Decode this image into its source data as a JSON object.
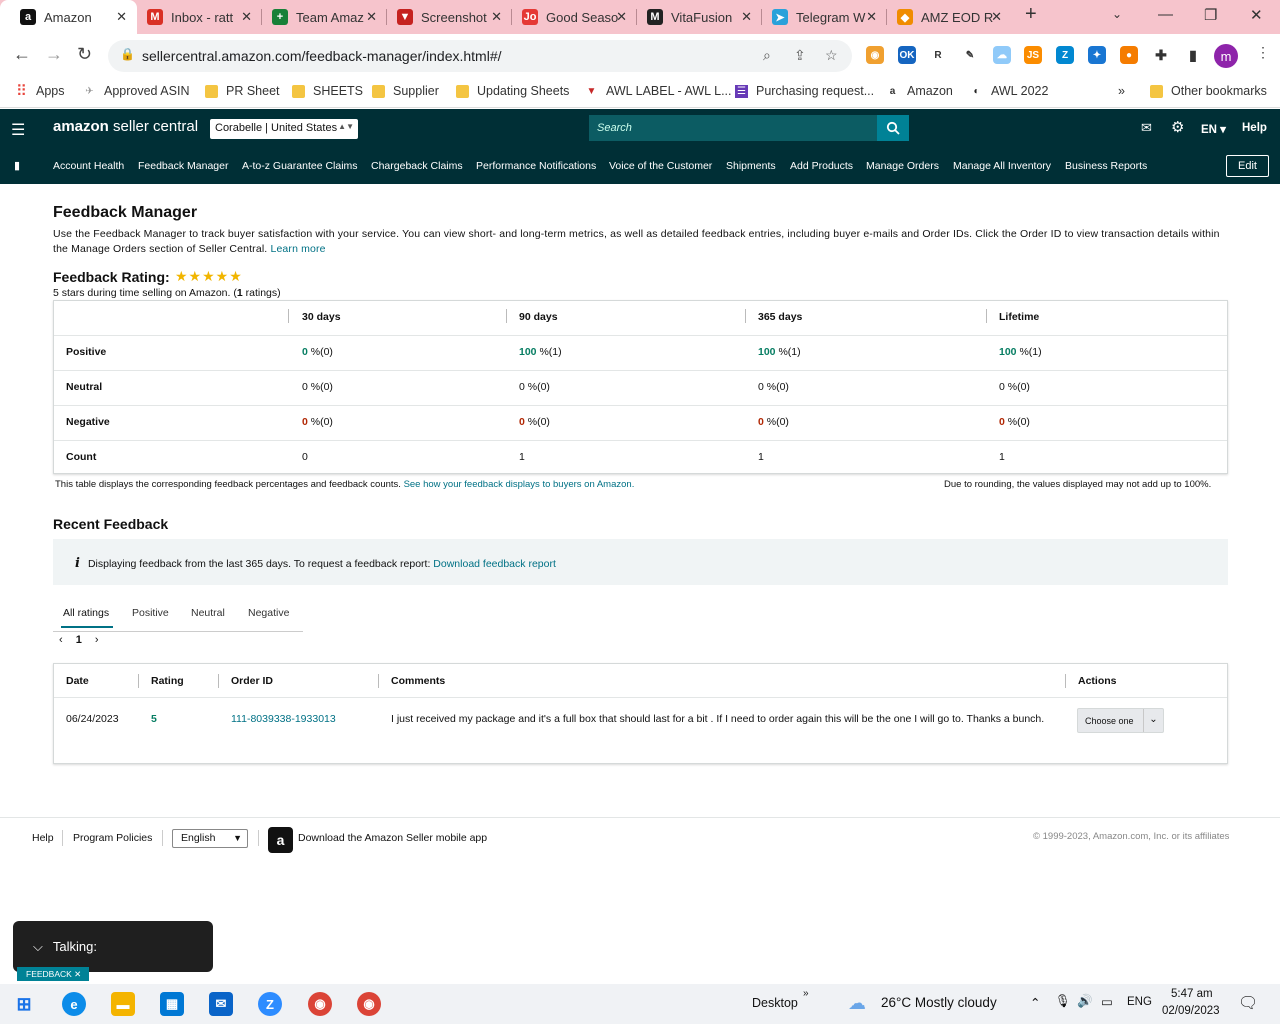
{
  "browser": {
    "tabs": [
      {
        "title": "Amazon",
        "icon": "amazon-a-icon",
        "color": "#111111",
        "letter": "a"
      },
      {
        "title": "Inbox - ratt",
        "icon": "gmail-icon",
        "color": "#d93025",
        "letter": "M"
      },
      {
        "title": "Team Amaz",
        "icon": "sheets-icon",
        "color": "#188038",
        "letter": "+"
      },
      {
        "title": "Screenshot",
        "icon": "screenshot-icon",
        "color": "#c5221f",
        "letter": "▼"
      },
      {
        "title": "Good Seaso",
        "icon": "jo-icon",
        "color": "#e53935",
        "letter": "Jo"
      },
      {
        "title": "VitaFusion",
        "icon": "vitafusion-icon",
        "color": "#222222",
        "letter": "M"
      },
      {
        "title": "Telegram W",
        "icon": "telegram-icon",
        "color": "#2aa1da",
        "letter": "➤"
      },
      {
        "title": "AMZ EOD R",
        "icon": "tag-icon",
        "color": "#f08c00",
        "letter": "◆"
      }
    ],
    "url": "sellercentral.amazon.com/feedback-manager/index.html#/",
    "profile_letter": "m",
    "bookmarks": [
      {
        "label": "Apps",
        "icon": "apps-grid-icon"
      },
      {
        "label": "Approved ASIN",
        "icon": "bookmark-icon"
      },
      {
        "label": "PR Sheet",
        "icon": "folder-icon"
      },
      {
        "label": "SHEETS",
        "icon": "folder-icon"
      },
      {
        "label": "Supplier",
        "icon": "folder-icon"
      },
      {
        "label": "Updating Sheets",
        "icon": "folder-icon"
      },
      {
        "label": "AWL LABEL - AWL L...",
        "icon": "awl-icon"
      },
      {
        "label": "Purchasing request...",
        "icon": "form-icon"
      },
      {
        "label": "Amazon",
        "icon": "amazon-a-icon"
      },
      {
        "label": "AWL 2022",
        "icon": "globe-icon"
      }
    ],
    "other_bookmarks": "Other bookmarks",
    "more_bookmarks": "»"
  },
  "header": {
    "logo_brand": "amazon",
    "logo_suffix": " seller central",
    "store": "Corabelle | United States",
    "search_placeholder": "Search",
    "language": "EN",
    "help": "Help"
  },
  "nav": {
    "items": [
      "Account Health",
      "Feedback Manager",
      "A-to-z Guarantee Claims",
      "Chargeback Claims",
      "Performance Notifications",
      "Voice of the Customer",
      "Shipments",
      "Add Products",
      "Manage Orders",
      "Manage All Inventory",
      "Business Reports"
    ],
    "edit": "Edit"
  },
  "page": {
    "title": "Feedback Manager",
    "intro": "Use the Feedback Manager to track buyer satisfaction with your service. You can view short- and long-term metrics, as well as detailed feedback entries, including buyer e-mails and Order IDs. Click the Order ID to view transaction details within the Manage Orders section of Seller Central.",
    "learn_more": "Learn more",
    "rating_label": "Feedback Rating:",
    "stars": "★★★★★",
    "rating_sub_pre": "5 stars during time selling on Amazon. (",
    "rating_count": "1",
    "rating_sub_post": " ratings)"
  },
  "feedback_table": {
    "columns": [
      "30 days",
      "90 days",
      "365 days",
      "Lifetime"
    ],
    "rows": [
      {
        "label": "Positive",
        "cells": [
          {
            "v": "0",
            "s": " %(0)",
            "c": "green"
          },
          {
            "v": "100",
            "s": " %(1)",
            "c": "green"
          },
          {
            "v": "100",
            "s": " %(1)",
            "c": "green"
          },
          {
            "v": "100",
            "s": " %(1)",
            "c": "green"
          }
        ]
      },
      {
        "label": "Neutral",
        "cells": [
          {
            "v": "0",
            "s": " %(0)",
            "c": ""
          },
          {
            "v": "0",
            "s": " %(0)",
            "c": ""
          },
          {
            "v": "0",
            "s": " %(0)",
            "c": ""
          },
          {
            "v": "0",
            "s": " %(0)",
            "c": ""
          }
        ]
      },
      {
        "label": "Negative",
        "cells": [
          {
            "v": "0",
            "s": " %(0)",
            "c": "red"
          },
          {
            "v": "0",
            "s": " %(0)",
            "c": "red"
          },
          {
            "v": "0",
            "s": " %(0)",
            "c": "red"
          },
          {
            "v": "0",
            "s": " %(0)",
            "c": "red"
          }
        ]
      },
      {
        "label": "Count",
        "cells": [
          {
            "v": "0",
            "s": "",
            "c": ""
          },
          {
            "v": "1",
            "s": "",
            "c": ""
          },
          {
            "v": "1",
            "s": "",
            "c": ""
          },
          {
            "v": "1",
            "s": "",
            "c": ""
          }
        ]
      }
    ],
    "note_left": "This table displays the corresponding feedback percentages and feedback counts.",
    "note_link": "See how your feedback displays to buyers on Amazon.",
    "note_right": "Due to rounding, the values displayed may not add up to 100%."
  },
  "recent": {
    "title": "Recent Feedback",
    "info": "Displaying feedback from the last 365 days. To request a feedback report:",
    "info_link": "Download feedback report",
    "filters": [
      "All ratings",
      "Positive",
      "Neutral",
      "Negative"
    ],
    "page": "1",
    "columns": [
      "Date",
      "Rating",
      "Order ID",
      "Comments",
      "Actions"
    ],
    "rows": [
      {
        "date": "06/24/2023",
        "rating": "5",
        "order_id": "111-8039338-1933013",
        "comment": "I just received my package and it's a full box that should last for a bit . If I need to order again this will be the one I will go to. Thanks a bunch.",
        "action": "Choose one"
      }
    ]
  },
  "footer": {
    "help": "Help",
    "policies": "Program Policies",
    "language": "English",
    "app": "Download the Amazon Seller mobile app",
    "copyright": "© 1999-2023, Amazon.com, Inc. or its affiliates"
  },
  "overlay": {
    "talking": "Talking:",
    "feedback_tab": "FEEDBACK ✕"
  },
  "taskbar": {
    "desktop": "Desktop",
    "weather": "26°C  Mostly cloudy",
    "lang": "ENG",
    "time": "5:47 am",
    "date": "02/09/2023"
  }
}
